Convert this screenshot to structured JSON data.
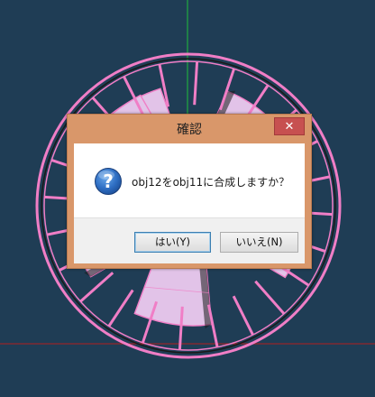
{
  "scene": {
    "background": "#1f3d55",
    "wheel_color": "#f07ec6",
    "blade_color": "#e2c3e8",
    "axis_green": "#1fbf3a",
    "axis_red": "#b02020"
  },
  "dialog": {
    "title": "確認",
    "close_glyph": "✕",
    "icon": "question-icon",
    "message": "obj12をobj11に合成しますか？",
    "yes_label": "はい(Y)",
    "no_label": "いいえ(N)",
    "frame_color": "#d9976a",
    "close_color": "#c75050"
  }
}
